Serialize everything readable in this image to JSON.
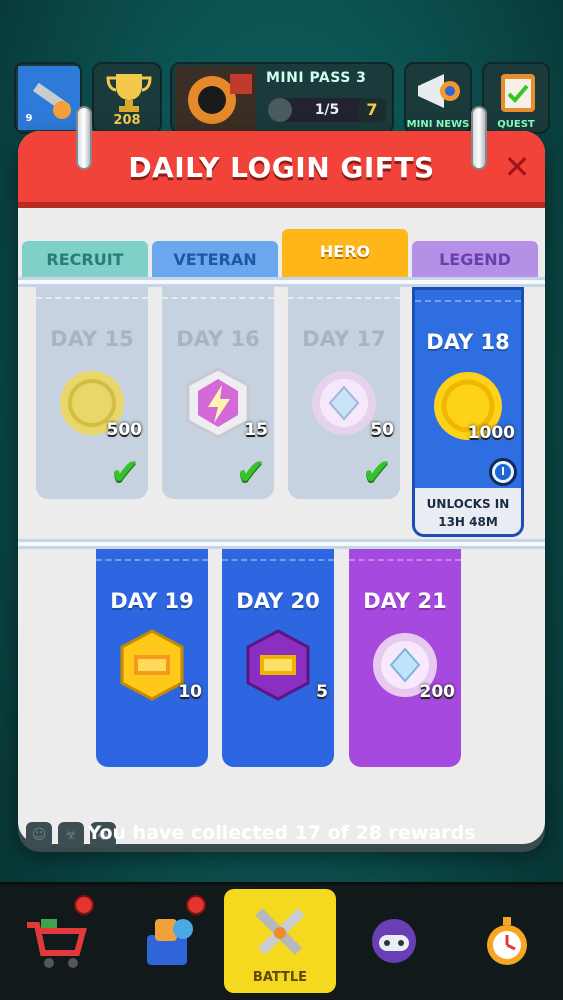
{
  "hud": {
    "level": "9",
    "trophies": "208",
    "mini_pass_title": "MINI PASS 3",
    "mini_pass_progress": "1/5",
    "mini_pass_progress_fraction": 0.2,
    "mini_pass_step": "7",
    "mini_news_label": "MINI NEWS",
    "quest_label": "QUEST"
  },
  "modal": {
    "title": "DAILY LOGIN GIFTS",
    "close_glyph": "✕"
  },
  "tabs": [
    {
      "label": "RECRUIT"
    },
    {
      "label": "VETERAN"
    },
    {
      "label": "HERO"
    },
    {
      "label": "LEGEND"
    }
  ],
  "rewards": [
    {
      "day": "DAY 15",
      "qty": "500",
      "icon": "gold-coin-icon",
      "claimed": true
    },
    {
      "day": "DAY 16",
      "qty": "15",
      "icon": "energy-bolt-icon",
      "claimed": true
    },
    {
      "day": "DAY 17",
      "qty": "50",
      "icon": "gem-icon",
      "claimed": true
    },
    {
      "day": "DAY 18",
      "qty": "1000",
      "icon": "gold-coin-icon",
      "unlocks_line1": "UNLOCKS IN",
      "unlocks_line2": "13H 48M"
    },
    {
      "day": "DAY 19",
      "qty": "10",
      "icon": "gold-ticket-hex-icon"
    },
    {
      "day": "DAY 20",
      "qty": "5",
      "icon": "purple-ticket-hex-icon"
    },
    {
      "day": "DAY 21",
      "qty": "200",
      "icon": "gem-icon"
    }
  ],
  "footer": {
    "text": "You have collected 17 of 28 rewards"
  },
  "nav": {
    "battle_label": "BATTLE"
  },
  "colors": {
    "header_red": "#f2433a",
    "hero_tab": "#ffb618",
    "check_green": "#36c22b",
    "card_blue": "#2d66e0",
    "card_purple": "#a649de"
  }
}
